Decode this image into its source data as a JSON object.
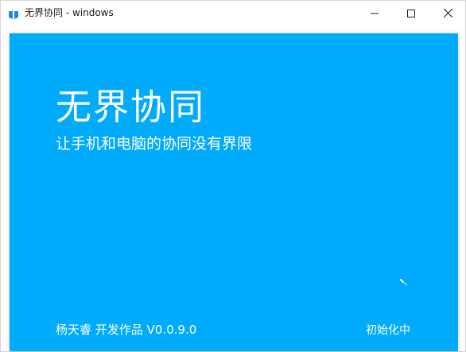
{
  "window": {
    "title": "无界协同 - windows",
    "icon": "app-book-icon",
    "controls": [
      "minimize-icon",
      "maximize-icon",
      "close-icon"
    ]
  },
  "splash": {
    "app_name": "无界协同",
    "tagline": "让手机和电脑的协同没有界限",
    "author": "杨天睿 开发作品 V0.0.9.0",
    "status": "初始化中",
    "background_color": "#00abfb",
    "text_color": "#ffffff",
    "loading_icon": "loading-spinner-icon"
  }
}
